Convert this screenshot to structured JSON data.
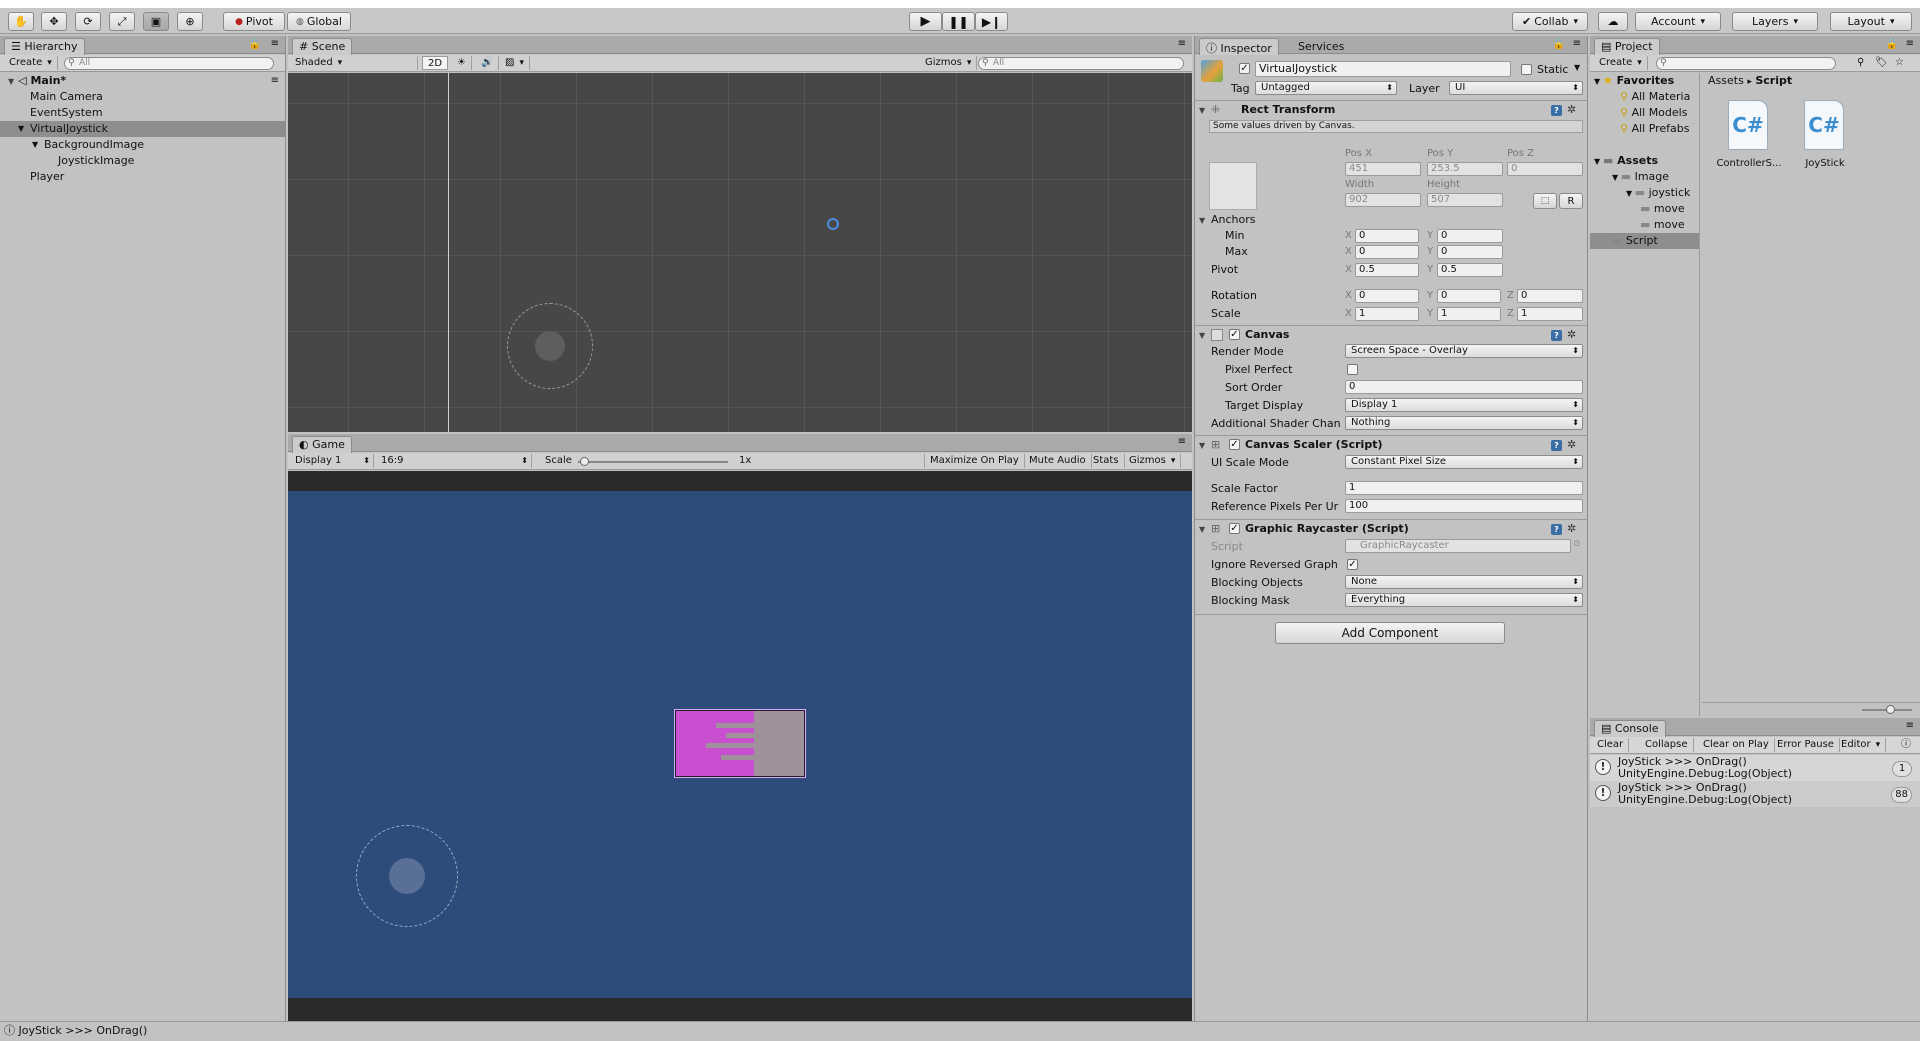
{
  "toolbar": {
    "tools": [
      "hand-tool",
      "move-tool",
      "rotate-tool",
      "scale-tool",
      "rect-tool",
      "transform-tool"
    ],
    "pivot_label": "Pivot",
    "global_label": "Global",
    "collab_label": "Collab",
    "account_label": "Account",
    "layers_label": "Layers",
    "layout_label": "Layout"
  },
  "hierarchy": {
    "tab": "Hierarchy",
    "create_label": "Create",
    "search_placeholder": "All",
    "scene_name": "Main*",
    "items": [
      {
        "label": "Main Camera",
        "indent": 0
      },
      {
        "label": "EventSystem",
        "indent": 0
      },
      {
        "label": "VirtualJoystick",
        "indent": 0,
        "selected": true
      },
      {
        "label": "BackgroundImage",
        "indent": 1
      },
      {
        "label": "JoystickImage",
        "indent": 2
      },
      {
        "label": "Player",
        "indent": 0
      }
    ]
  },
  "scene": {
    "tab": "Scene",
    "shading": "Shaded",
    "mode_2d": "2D",
    "gizmos_label": "Gizmos",
    "search_placeholder": "All"
  },
  "game": {
    "tab": "Game",
    "display": "Display 1",
    "aspect": "16:9",
    "scale_label": "Scale",
    "scale_value": "1x",
    "maximize_label": "Maximize On Play",
    "mute_label": "Mute Audio",
    "stats_label": "Stats",
    "gizmos_label": "Gizmos",
    "background_color": "#2e4c7a",
    "sprite_color": "#c84fd0"
  },
  "inspector": {
    "tab": "Inspector",
    "tab2": "Services",
    "object_name": "VirtualJoystick",
    "static_label": "Static",
    "tag_label": "Tag",
    "tag_value": "Untagged",
    "layer_label": "Layer",
    "layer_value": "UI",
    "rect": {
      "title": "Rect Transform",
      "note": "Some values driven by Canvas.",
      "posx_label": "Pos X",
      "posy_label": "Pos Y",
      "posz_label": "Pos Z",
      "posx": "451",
      "posy": "253.5",
      "posz": "0",
      "width_label": "Width",
      "height_label": "Height",
      "width": "902",
      "height": "507",
      "r_label": "R",
      "anchors_label": "Anchors",
      "min_label": "Min",
      "max_label": "Max",
      "min_x": "0",
      "min_y": "0",
      "max_x": "0",
      "max_y": "0",
      "pivot_label": "Pivot",
      "pivot_x": "0.5",
      "pivot_y": "0.5",
      "rotation_label": "Rotation",
      "rot_x": "0",
      "rot_y": "0",
      "rot_z": "0",
      "scale_label": "Scale",
      "scale_x": "1",
      "scale_y": "1",
      "scale_z": "1"
    },
    "canvas": {
      "title": "Canvas",
      "render_mode_label": "Render Mode",
      "render_mode": "Screen Space - Overlay",
      "pixel_perfect_label": "Pixel Perfect",
      "sort_order_label": "Sort Order",
      "sort_order": "0",
      "target_display_label": "Target Display",
      "target_display": "Display 1",
      "shader_label": "Additional Shader Chan",
      "shader_value": "Nothing"
    },
    "scaler": {
      "title": "Canvas Scaler (Script)",
      "ui_scale_label": "UI Scale Mode",
      "ui_scale": "Constant Pixel Size",
      "scale_factor_label": "Scale Factor",
      "scale_factor": "1",
      "ref_pixels_label": "Reference Pixels Per Ur",
      "ref_pixels": "100"
    },
    "raycaster": {
      "title": "Graphic Raycaster (Script)",
      "script_label": "Script",
      "script_value": "GraphicRaycaster",
      "ignore_label": "Ignore Reversed Graph",
      "blocking_objects_label": "Blocking Objects",
      "blocking_objects": "None",
      "blocking_mask_label": "Blocking Mask",
      "blocking_mask": "Everything"
    },
    "add_component": "Add Component"
  },
  "project": {
    "tab": "Project",
    "create_label": "Create",
    "favorites_label": "Favorites",
    "favorites": [
      "All Materia",
      "All Models",
      "All Prefabs"
    ],
    "assets_label": "Assets",
    "tree": [
      {
        "label": "Image",
        "indent": 1
      },
      {
        "label": "joystick",
        "indent": 2
      },
      {
        "label": "move",
        "indent": 3
      },
      {
        "label": "move",
        "indent": 3
      },
      {
        "label": "Script",
        "indent": 1,
        "selected": true
      }
    ],
    "breadcrumb_root": "Assets",
    "breadcrumb_sep": "▸",
    "breadcrumb_current": "Script",
    "files": [
      {
        "label": "ControllerS..."
      },
      {
        "label": "JoyStick"
      }
    ]
  },
  "console": {
    "tab": "Console",
    "clear": "Clear",
    "collapse": "Collapse",
    "clear_on_play": "Clear on Play",
    "error_pause": "Error Pause",
    "editor": "Editor",
    "entries": [
      {
        "line1": "JoyStick >>> OnDrag()",
        "line2": "UnityEngine.Debug:Log(Object)",
        "count": "1"
      },
      {
        "line1": "JoyStick >>> OnDrag()",
        "line2": "UnityEngine.Debug:Log(Object)",
        "count": "88"
      }
    ]
  },
  "statusbar": {
    "message": "JoyStick >>> OnDrag()"
  }
}
